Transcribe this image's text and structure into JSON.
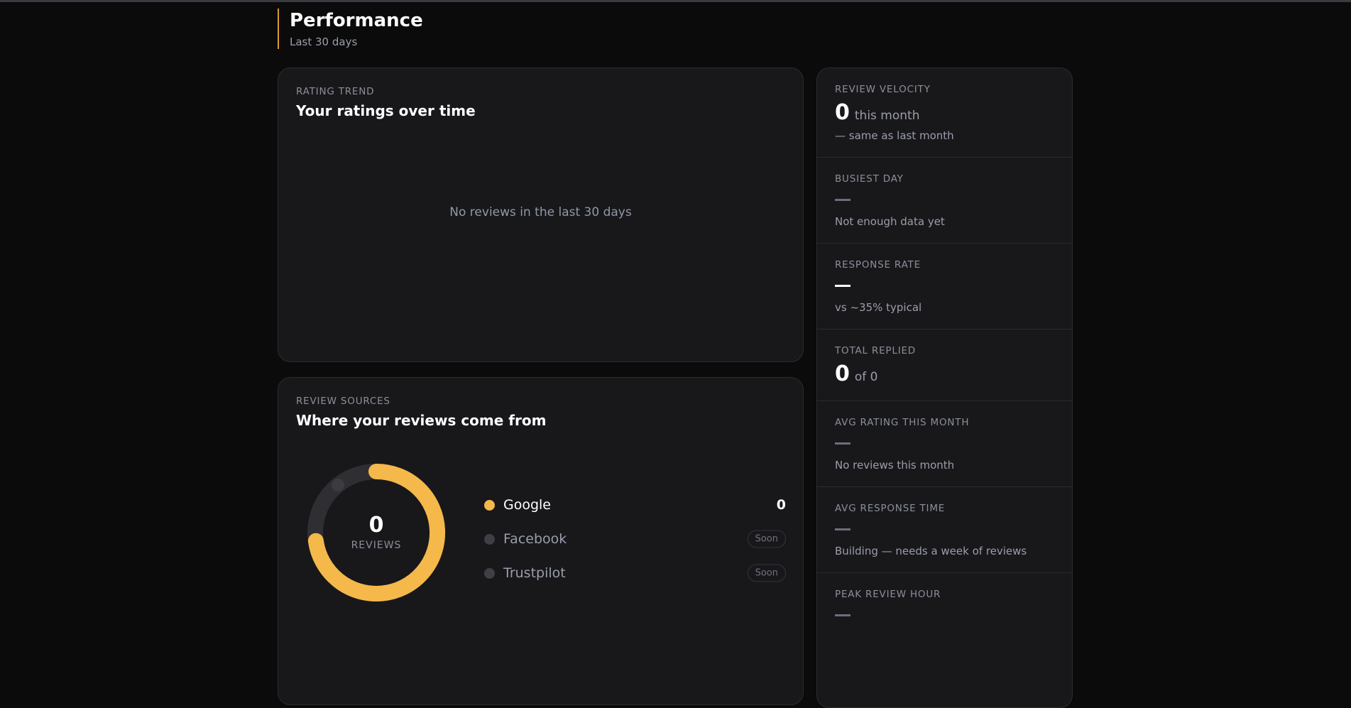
{
  "header": {
    "title": "Performance",
    "subtitle": "Last 30 days"
  },
  "trend": {
    "eyebrow": "RATING TREND",
    "title": "Your ratings over time",
    "empty_message": "No reviews in the last 30 days"
  },
  "sources": {
    "eyebrow": "REVIEW SOURCES",
    "title": "Where your reviews come from",
    "total_value": "0",
    "total_label": "REVIEWS",
    "items": [
      {
        "name": "Google",
        "value": "0",
        "color": "#f5b84a"
      },
      {
        "name": "Facebook",
        "badge": "Soon",
        "color": "#3f4045"
      },
      {
        "name": "Trustpilot",
        "badge": "Soon",
        "color": "#3f4045"
      }
    ]
  },
  "metrics": {
    "items": [
      {
        "label": "REVIEW VELOCITY",
        "value": "0",
        "unit": "this month",
        "note": "— same as last month"
      },
      {
        "label": "BUSIEST DAY",
        "note": "Not enough data yet"
      },
      {
        "label": "RESPONSE RATE",
        "note": "vs ~35% typical"
      },
      {
        "label": "TOTAL REPLIED",
        "value": "0",
        "unit": "of 0"
      },
      {
        "label": "AVG RATING THIS MONTH",
        "note": "No reviews this month"
      },
      {
        "label": "AVG RESPONSE TIME",
        "note": "Building — needs a week of reviews"
      },
      {
        "label": "PEAK REVIEW HOUR"
      }
    ]
  },
  "colors": {
    "accent": "#f5b84a",
    "header_rule": "#d79a2c",
    "card_bg": "#18181a",
    "page_bg": "#0b0b0c"
  }
}
